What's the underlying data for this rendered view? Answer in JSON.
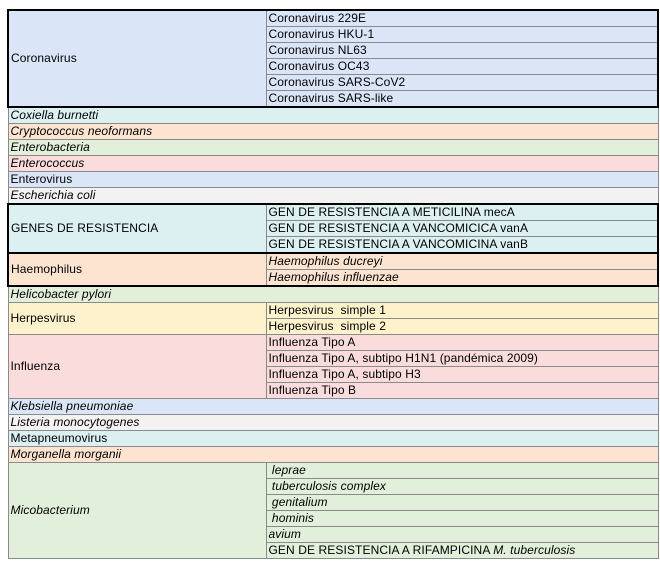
{
  "rows": [
    {
      "label": "Coronavirus",
      "italic": false,
      "color": "blue",
      "boxed": true,
      "subs": [
        {
          "text": "Coronavirus 229E",
          "italic": false
        },
        {
          "text": "Coronavirus HKU-1",
          "italic": false
        },
        {
          "text": "Coronavirus NL63",
          "italic": false
        },
        {
          "text": "Coronavirus OC43",
          "italic": false
        },
        {
          "text": "Coronavirus SARS-CoV2",
          "italic": false
        },
        {
          "text": "Coronavirus SARS-like",
          "italic": false
        }
      ]
    },
    {
      "label": "Coxiella burnetti",
      "italic": true,
      "color": "cyan",
      "subs": []
    },
    {
      "label": "Cryptococcus neoformans",
      "italic": true,
      "color": "orange",
      "subs": []
    },
    {
      "label": "Enterobacteria",
      "italic": true,
      "color": "green",
      "subs": []
    },
    {
      "label": "Enterococcus",
      "italic": true,
      "color": "pink",
      "subs": []
    },
    {
      "label": "Enterovirus",
      "italic": false,
      "color": "blue",
      "subs": []
    },
    {
      "label": "Escherichia coli",
      "italic": true,
      "color": "gray",
      "subs": []
    },
    {
      "label": "GENES DE RESISTENCIA",
      "italic": false,
      "color": "cyan",
      "boxed": true,
      "subs": [
        {
          "text": "GEN DE RESISTENCIA A METICILINA mecA",
          "italic": false
        },
        {
          "text": "GEN DE RESISTENCIA A VANCOMICICA vanA",
          "italic": false
        },
        {
          "text": "GEN DE RESISTENCIA A VANCOMICINA vanB",
          "italic": false
        }
      ]
    },
    {
      "label": "Haemophilus",
      "italic": false,
      "color": "orange",
      "boxed": true,
      "subs": [
        {
          "text": "Haemophilus ducreyi",
          "italic": true
        },
        {
          "text": "Haemophilus influenzae",
          "italic": true
        }
      ]
    },
    {
      "label": "Helicobacter pylori",
      "italic": true,
      "color": "green",
      "subs": []
    },
    {
      "label": "Herpesvirus",
      "italic": false,
      "color": "yellow",
      "subs": [
        {
          "text": "Herpesvirus  simple 1",
          "italic": false
        },
        {
          "text": "Herpesvirus  simple 2",
          "italic": false
        }
      ]
    },
    {
      "label": "Influenza",
      "italic": false,
      "color": "pink",
      "subs": [
        {
          "text": "Influenza Tipo A",
          "italic": false
        },
        {
          "text": "Influenza Tipo A, subtipo H1N1 (pandémica 2009)",
          "italic": false
        },
        {
          "text": "Influenza Tipo A, subtipo H3",
          "italic": false
        },
        {
          "text": "Influenza Tipo B",
          "italic": false
        }
      ]
    },
    {
      "label": "Klebsiella pneumoniae",
      "italic": true,
      "color": "blue",
      "subs": []
    },
    {
      "label": "Listeria monocytogenes",
      "italic": true,
      "color": "gray",
      "subs": []
    },
    {
      "label": "Metapneumovirus",
      "italic": false,
      "color": "cyan",
      "subs": []
    },
    {
      "label": "Morganella morganii",
      "italic": true,
      "color": "orange",
      "subs": []
    },
    {
      "label": "Micobacterium",
      "italic": true,
      "color": "green",
      "subs": [
        {
          "text": " leprae",
          "italic": true
        },
        {
          "text": " tuberculosis complex",
          "italic": true
        },
        {
          "text": " genitalium",
          "italic": true
        },
        {
          "text": " hominis",
          "italic": true
        },
        {
          "text": "avium",
          "italic": true
        },
        {
          "text": "GEN DE RESISTENCIA A RIFAMPICINA ",
          "italic": false,
          "suffix": "M. tuberculosis"
        }
      ]
    }
  ]
}
